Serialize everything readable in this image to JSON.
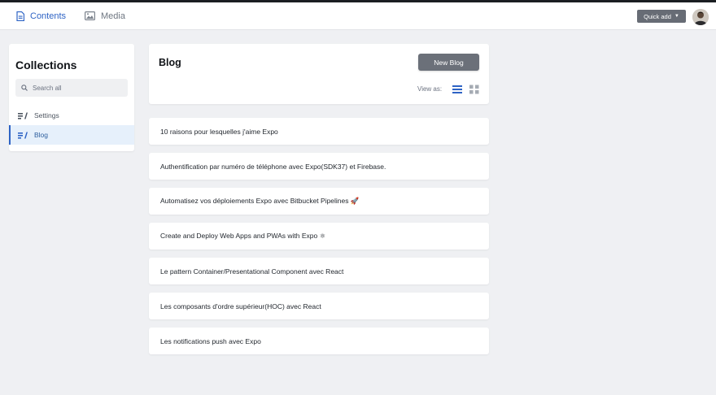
{
  "nav": {
    "contents_label": "Contents",
    "media_label": "Media",
    "quick_add_label": "Quick add",
    "contents_icon": "document-icon",
    "media_icon": "image-icon"
  },
  "sidebar": {
    "title": "Collections",
    "search_placeholder": "Search all",
    "items": [
      {
        "label": "Settings",
        "icon": "collection-icon"
      },
      {
        "label": "Blog",
        "icon": "collection-icon",
        "active": true
      }
    ]
  },
  "main": {
    "title": "Blog",
    "new_button_label": "New Blog",
    "view_as_label": "View as:",
    "entries": [
      "10 raisons pour lesquelles j'aime Expo",
      "Authentification par numéro de téléphone avec Expo(SDK37) et Firebase.",
      "Automatisez vos déploiements Expo avec Bitbucket Pipelines 🚀",
      "Create and Deploy Web Apps and PWAs with Expo ⚛",
      "Le pattern Container/Presentational Component avec React",
      "Les composants d'ordre supérieur(HOC) avec React",
      "Les notifications push avec Expo"
    ]
  },
  "colors": {
    "accent": "#2e63c5",
    "background": "#eff0f3",
    "button": "#6b7079"
  }
}
